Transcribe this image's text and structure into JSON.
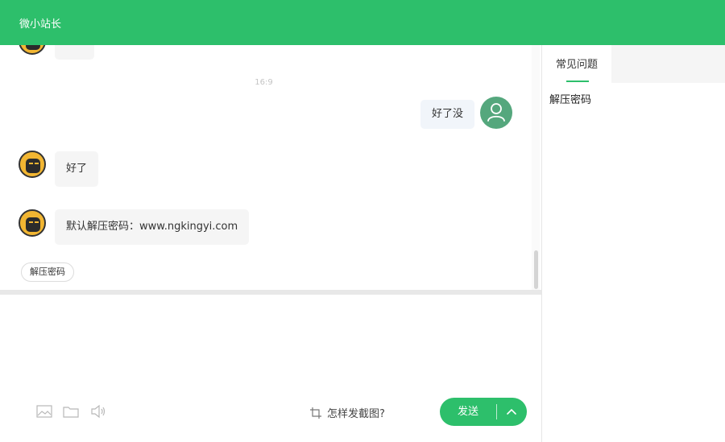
{
  "app": {
    "title": "微小站长"
  },
  "chat": {
    "time_label": "16:9",
    "messages": [
      {
        "from": "user",
        "text": "好了没"
      },
      {
        "from": "bot",
        "text": "好了"
      },
      {
        "from": "bot",
        "text": "默认解压密码：www.ngkingyi.com"
      }
    ],
    "quick_reply": "解压密码"
  },
  "input": {
    "tools": [
      "image-icon",
      "folder-icon",
      "speaker-icon"
    ],
    "screenshot_tip": "怎样发截图?",
    "send_label": "发送"
  },
  "sidebar": {
    "tab_label": "常见问题",
    "faq_items": [
      "解压密码"
    ]
  },
  "colors": {
    "accent": "#2dbf6b",
    "user_avatar": "#55a77d",
    "bot_avatar": "#f2b632"
  }
}
